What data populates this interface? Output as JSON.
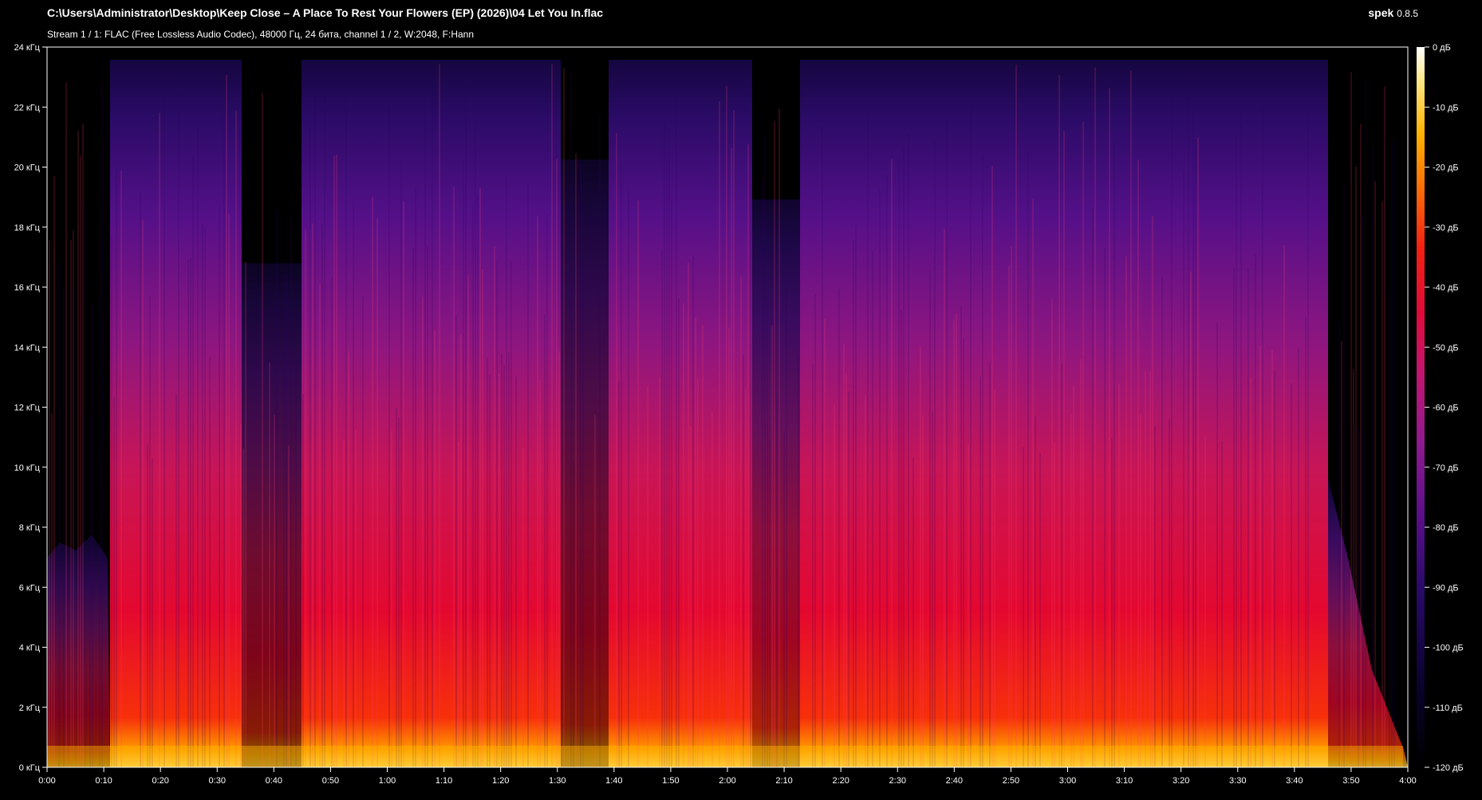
{
  "window": {
    "file_path": "C:\\Users\\Administrator\\Desktop\\Keep Close – A Place To Rest Your Flowers (EP) (2026)\\04 Let You In.flac",
    "app_name": "spek",
    "app_version": "0.8.5",
    "stream_info": "Stream 1 / 1: FLAC (Free Lossless Audio Codec), 48000 Гц, 24 бита, channel 1 / 2, W:2048, F:Hann"
  },
  "axes": {
    "freq_ticks": [
      "0 кГц",
      "2 кГц",
      "4 кГц",
      "6 кГц",
      "8 кГц",
      "10 кГц",
      "12 кГц",
      "14 кГц",
      "16 кГц",
      "18 кГц",
      "20 кГц",
      "22 кГц",
      "24 кГц"
    ],
    "time_ticks": [
      "0:00",
      "0:10",
      "0:20",
      "0:30",
      "0:40",
      "0:50",
      "1:00",
      "1:10",
      "1:20",
      "1:30",
      "1:40",
      "1:50",
      "2:00",
      "2:10",
      "2:20",
      "2:30",
      "2:40",
      "2:50",
      "3:00",
      "3:10",
      "3:20",
      "3:30",
      "3:40",
      "3:50",
      "4:00"
    ],
    "db_ticks": [
      "0 дБ",
      "-10 дБ",
      "-20 дБ",
      "-30 дБ",
      "-40 дБ",
      "-50 дБ",
      "-60 дБ",
      "-70 дБ",
      "-80 дБ",
      "-90 дБ",
      "-100 дБ",
      "-110 дБ",
      "-120 дБ"
    ]
  },
  "colors": {
    "background": "#000000",
    "palette": [
      "#000000",
      "#0b0330",
      "#2a0a6a",
      "#5b0f8a",
      "#8e1a8f",
      "#c4156e",
      "#e00a3a",
      "#f51f12",
      "#fb6a08",
      "#ffb300",
      "#ffe680",
      "#ffffff"
    ]
  }
}
